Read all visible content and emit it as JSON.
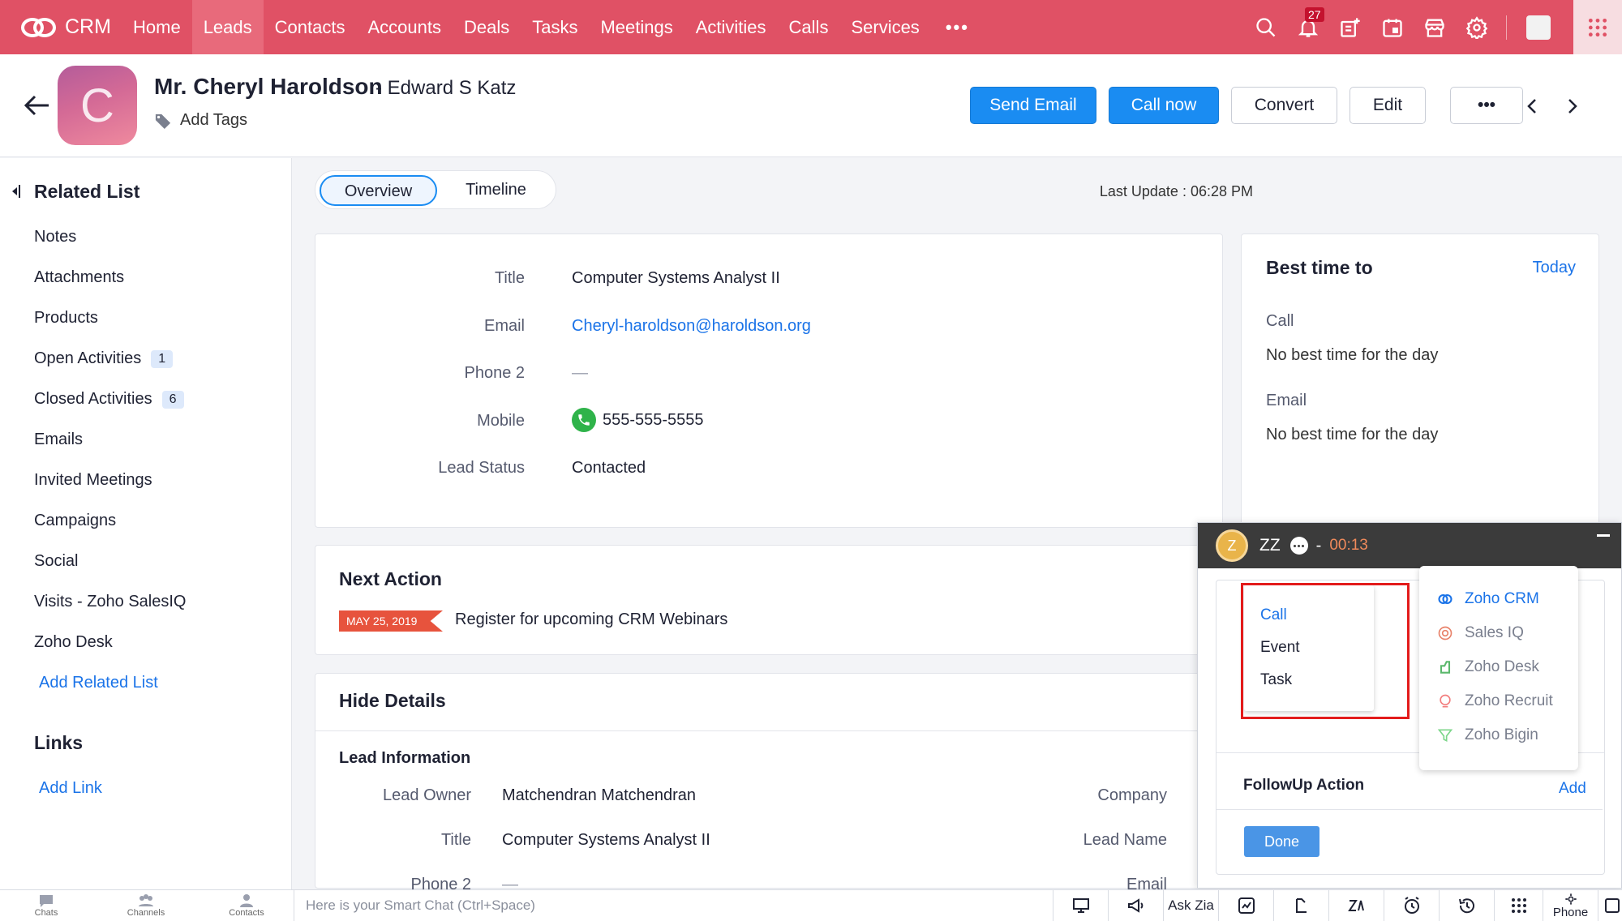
{
  "nav": {
    "brand": "CRM",
    "tabs": [
      "Home",
      "Leads",
      "Contacts",
      "Accounts",
      "Deals",
      "Tasks",
      "Meetings",
      "Activities",
      "Calls",
      "Services"
    ],
    "active_tab": "Leads",
    "notification_count": "27",
    "accent_color": "#e05165"
  },
  "record": {
    "avatar_letter": "C",
    "name": "Mr. Cheryl Haroldson",
    "subtitle": "- Edward S Katz",
    "add_tags": "Add Tags",
    "buttons": {
      "send_email": "Send Email",
      "call_now": "Call now",
      "convert": "Convert",
      "edit": "Edit",
      "more": "•••"
    }
  },
  "related_list": {
    "title": "Related List",
    "items": [
      {
        "label": "Notes"
      },
      {
        "label": "Attachments"
      },
      {
        "label": "Products"
      },
      {
        "label": "Open Activities",
        "count": "1"
      },
      {
        "label": "Closed Activities",
        "count": "6"
      },
      {
        "label": "Emails"
      },
      {
        "label": "Invited Meetings"
      },
      {
        "label": "Campaigns"
      },
      {
        "label": "Social"
      },
      {
        "label": "Visits - Zoho SalesIQ"
      },
      {
        "label": "Zoho Desk"
      }
    ],
    "add_related": "Add Related List",
    "links_title": "Links",
    "add_link": "Add Link"
  },
  "view_tabs": {
    "overview": "Overview",
    "timeline": "Timeline",
    "last_update": "Last Update : 06:28 PM"
  },
  "overview": {
    "fields": [
      {
        "label": "Title",
        "value": "Computer Systems Analyst II"
      },
      {
        "label": "Email",
        "value": "Cheryl-haroldson@haroldson.org"
      },
      {
        "label": "Phone 2",
        "value": "—"
      },
      {
        "label": "Mobile",
        "value": "555-555-5555"
      },
      {
        "label": "Lead Status",
        "value": "Contacted"
      }
    ]
  },
  "best_time": {
    "title": "Best time to",
    "today": "Today",
    "call_label": "Call",
    "call_value": "No best time for the day",
    "email_label": "Email",
    "email_value": "No best time for the day"
  },
  "next_action": {
    "title": "Next Action",
    "date": "MAY 25, 2019",
    "text": "Register for upcoming CRM Webinars"
  },
  "details": {
    "title": "Hide Details",
    "section": "Lead Information",
    "rows": [
      {
        "label": "Lead Owner",
        "value": "Matchendran Matchendran",
        "right_label": "Company"
      },
      {
        "label": "Title",
        "value": "Computer Systems Analyst II",
        "right_label": "Lead Name"
      },
      {
        "label": "Phone 2",
        "value": "—",
        "right_label": "Email"
      }
    ]
  },
  "call_widget": {
    "avatar": "Z",
    "caller": "ZZ",
    "dash": "-",
    "timer": "00:13",
    "type_menu": [
      "Call",
      "Event",
      "Task"
    ],
    "apps": [
      {
        "label": "Zoho CRM",
        "icon": "zoho-crm-icon",
        "color": "#1a73e8"
      },
      {
        "label": "Sales IQ",
        "icon": "salesiq-icon",
        "color": "#e8826a"
      },
      {
        "label": "Zoho Desk",
        "icon": "zoho-desk-icon",
        "color": "#5bb86c"
      },
      {
        "label": "Zoho Recruit",
        "icon": "zoho-recruit-icon",
        "color": "#f27d7d"
      },
      {
        "label": "Zoho Bigin",
        "icon": "zoho-bigin-icon",
        "color": "#7cd68a"
      }
    ],
    "followup_title": "FollowUp Action",
    "followup_add": "Add",
    "done": "Done"
  },
  "bottom_bar": {
    "chats": "Chats",
    "channels": "Channels",
    "contacts": "Contacts",
    "smart_chat_placeholder": "Here is your Smart Chat (Ctrl+Space)",
    "ask_zia": "Ask Zia",
    "phone": "Phone"
  }
}
